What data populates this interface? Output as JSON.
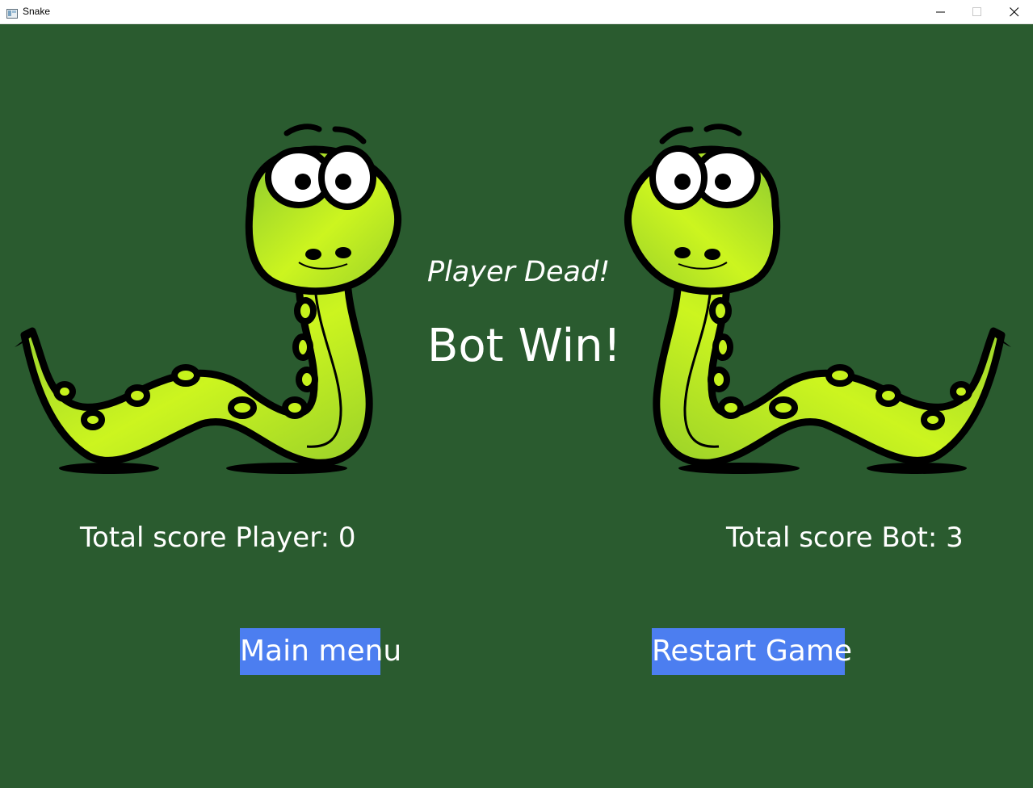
{
  "window": {
    "title": "Snake",
    "icon": "window-app-icon",
    "controls": [
      "minimize-icon",
      "maximize-icon",
      "close-icon"
    ]
  },
  "game_over": {
    "status_text": "Player Dead!",
    "result_text": "Bot Win!",
    "player_score_text": "Total score Player: 0",
    "bot_score_text": "Total score Bot: 3",
    "player_score": 0,
    "bot_score": 3
  },
  "buttons": {
    "main_menu_label": "Main menu",
    "restart_label": "Restart Game"
  },
  "colors": {
    "background": "#2a5b2f",
    "button": "#4c7ef0",
    "text": "#ffffff",
    "snake_body": "#c6f21c"
  }
}
